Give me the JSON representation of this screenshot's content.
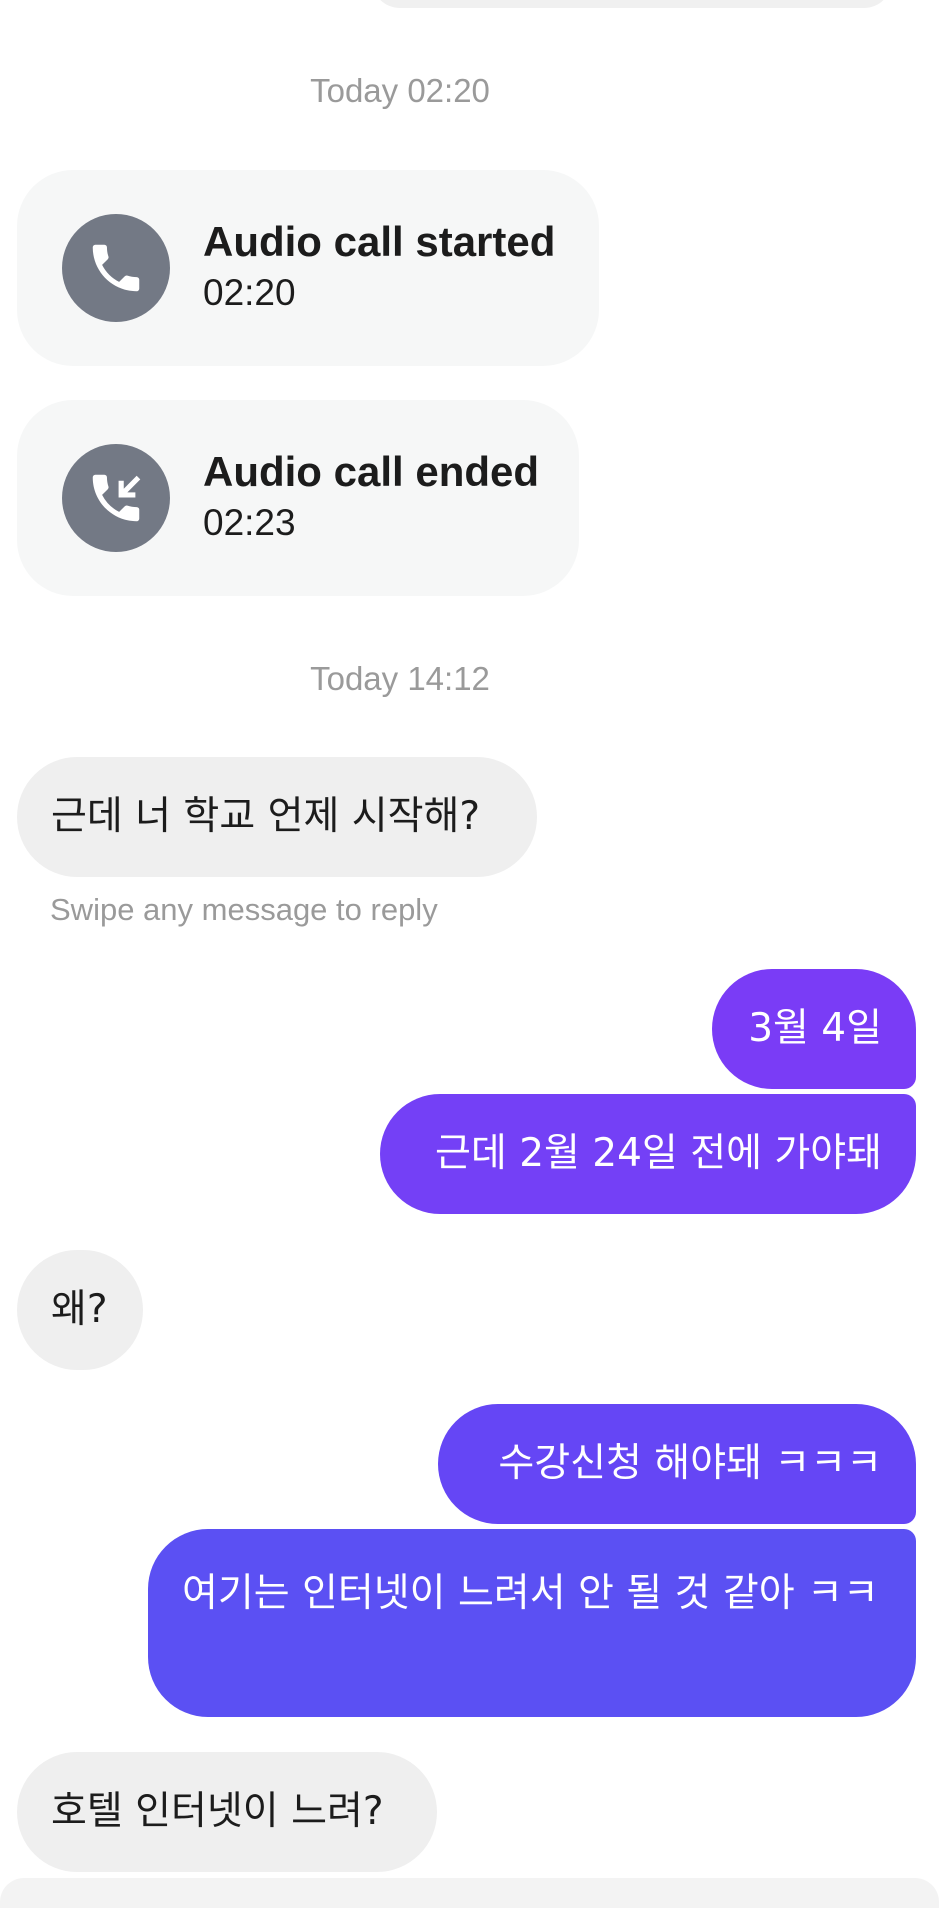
{
  "timestamps": {
    "first": "Today 02:20",
    "second": "Today 14:12"
  },
  "calls": [
    {
      "title": "Audio call started",
      "time": "02:20",
      "icon": "phone-icon"
    },
    {
      "title": "Audio call ended",
      "time": "02:23",
      "icon": "phone-incoming-icon"
    }
  ],
  "hint": "Swipe any message to reply",
  "messages": [
    {
      "side": "in",
      "text": "근데 너 학교 언제 시작해?"
    },
    {
      "side": "out",
      "text": "3월 4일"
    },
    {
      "side": "out",
      "text": "근데 2월 24일 전에 가야돼"
    },
    {
      "side": "in",
      "text": "왜?"
    },
    {
      "side": "out",
      "text": "수강신청 해야돼 ㅋㅋㅋ"
    },
    {
      "side": "out",
      "text": "여기는 인터넷이 느려서 안 될 것 같아 ㅋㅋ"
    },
    {
      "side": "in",
      "text": "호텔 인터넷이 느려?"
    }
  ],
  "colors": {
    "outgoing_top": "#7a3cf6",
    "outgoing_bottom": "#5b50f3",
    "incoming": "#efefef",
    "call_card": "#f6f7f7",
    "call_icon": "#737985",
    "muted_text": "#9a9a9a"
  }
}
